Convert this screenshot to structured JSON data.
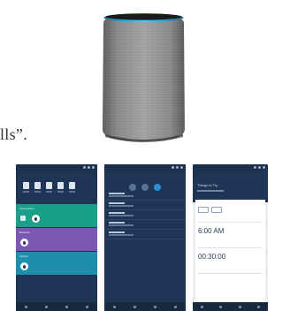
{
  "caption": {
    "text": "lls”."
  },
  "speaker": {
    "ring_color": "#27b6e6",
    "body_color": "#8c8c8c"
  },
  "screens": {
    "screen_1": {
      "cards": [
        {
          "label": "Living Room",
          "color": "#18a088"
        },
        {
          "label": "Bedroom",
          "color": "#7b58b4"
        },
        {
          "label": "Kitchen",
          "color": "#1d8fab"
        }
      ]
    },
    "screen_3": {
      "header": "Things to Try",
      "alarm_time": "6:00 AM",
      "timer_value": "00:30:00"
    }
  }
}
